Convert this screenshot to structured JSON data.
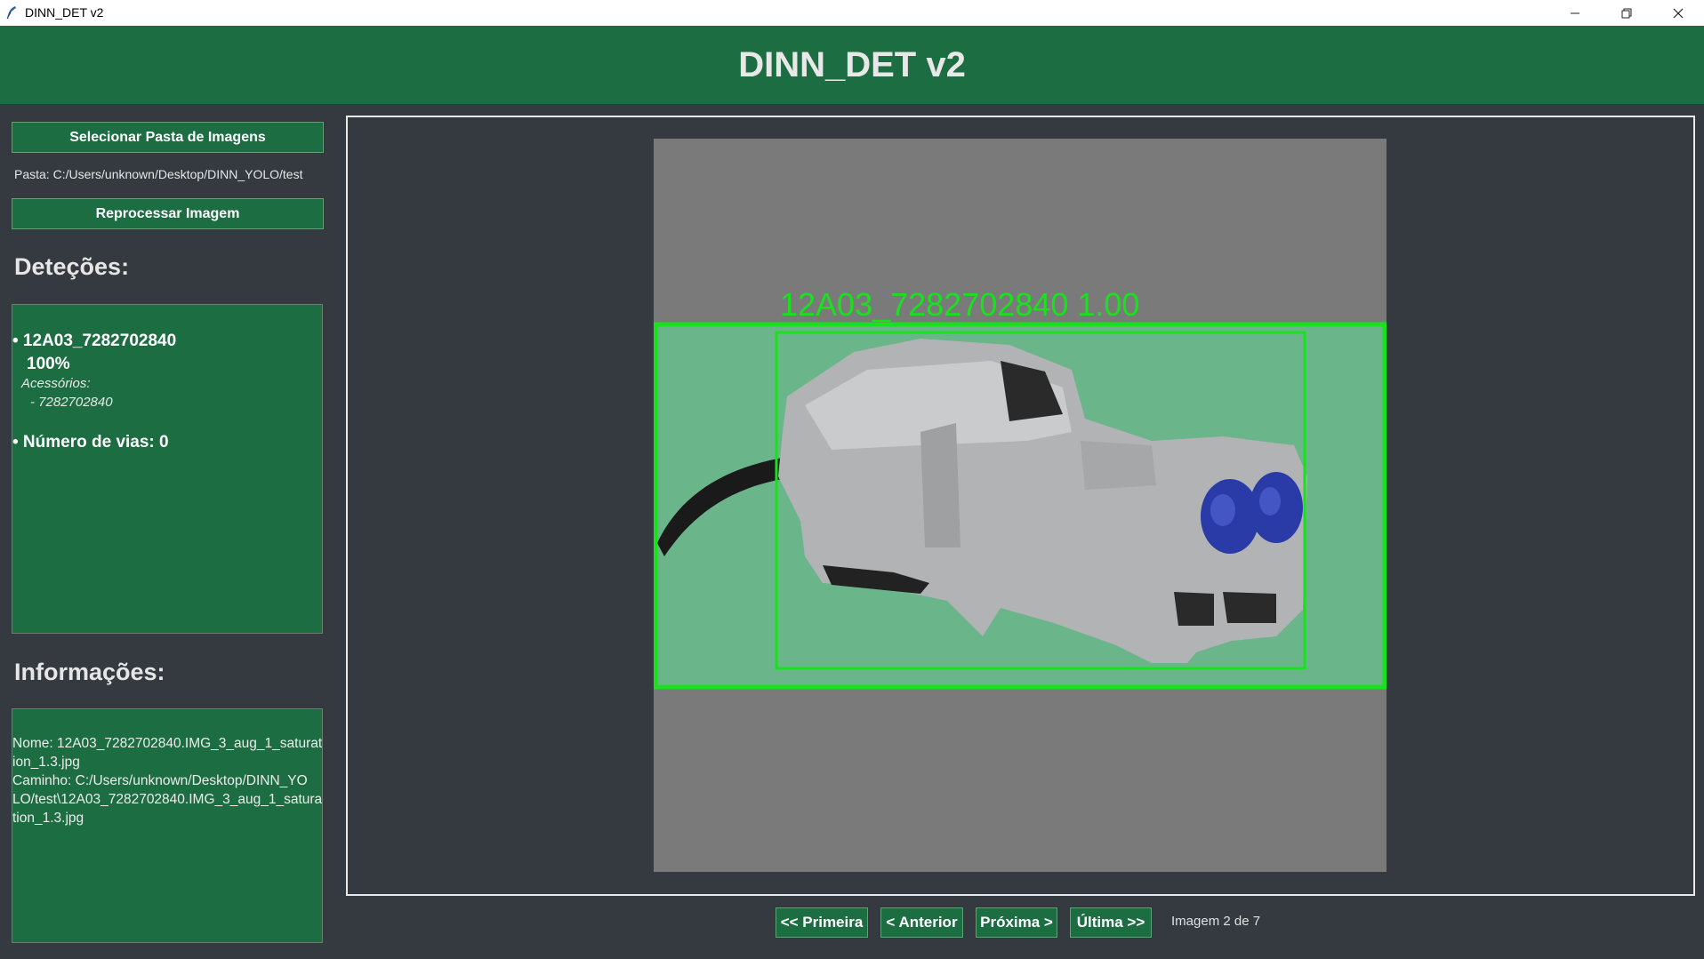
{
  "window": {
    "title": "DINN_DET v2",
    "controls": [
      "minimize-icon",
      "restore-icon",
      "close-icon"
    ]
  },
  "header": {
    "title": "DINN_DET v2"
  },
  "sidebar": {
    "select_folder_label": "Selecionar Pasta de Imagens",
    "folder_path": "Pasta: C:/Users/unknown/Desktop/DINN_YOLO/test",
    "reprocess_label": "Reprocessar Imagem",
    "detections_title": "Deteções:",
    "detection": {
      "name": "• 12A03_7282702840",
      "confidence": "100%",
      "accessories_label": "Acessórios:",
      "accessory": "- 7282702840",
      "vias": "• Número de vias: 0"
    },
    "info_title": "Informações:",
    "info_lines": [
      "Nome: 12A03_7282702840.IMG_3_aug_1_saturat",
      "ion_1.3.jpg",
      "Caminho: C:/Users/unknown/Desktop/DINN_YO",
      "LO/test\\12A03_7282702840.IMG_3_aug_1_satura",
      "tion_1.3.jpg"
    ]
  },
  "viewer": {
    "box_label": "12A03_7282702840 1.00",
    "colors": {
      "box": "#18e21c",
      "background": "#6bb58a",
      "canvas": "#7a7a7a"
    }
  },
  "navigation": {
    "first_label": "<< Primeira",
    "prev_label": "< Anterior",
    "next_label": "Próxima >",
    "last_label": "Última >>",
    "counter": "Imagem 2 de 7"
  },
  "colors": {
    "accent": "#1c6e42",
    "background": "#343a40",
    "text": "#e6e6e6"
  }
}
